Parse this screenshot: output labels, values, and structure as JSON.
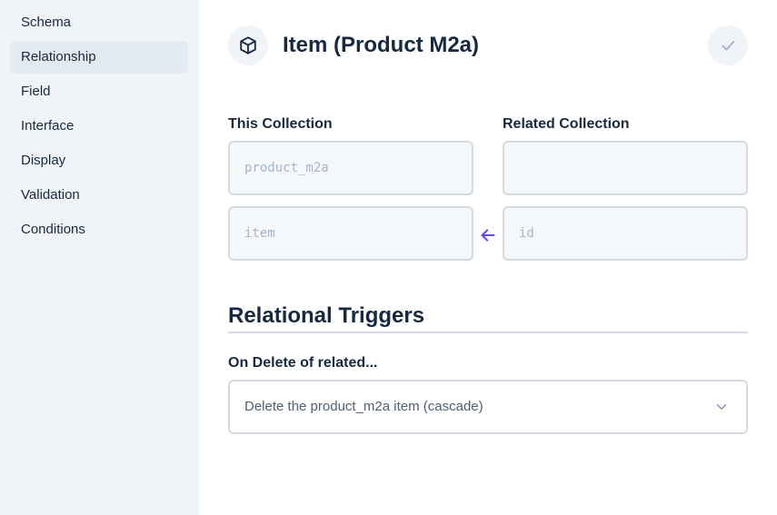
{
  "sidebar": {
    "items": [
      {
        "label": "Schema"
      },
      {
        "label": "Relationship",
        "active": true
      },
      {
        "label": "Field"
      },
      {
        "label": "Interface"
      },
      {
        "label": "Display"
      },
      {
        "label": "Validation"
      },
      {
        "label": "Conditions"
      }
    ]
  },
  "header": {
    "title": "Item (Product M2a)",
    "icon": "box-icon",
    "save_icon": "check-icon"
  },
  "relationship": {
    "this_collection_label": "This Collection",
    "related_collection_label": "Related Collection",
    "this_collection_value": "product_m2a",
    "related_collection_value": "",
    "this_field_value": "item",
    "related_field_value": "id",
    "arrow_icon": "arrow-left-icon"
  },
  "triggers": {
    "title": "Relational Triggers",
    "on_delete_label": "On Delete of related...",
    "on_delete_value": "Delete the product_m2a item (cascade)"
  },
  "colors": {
    "accent": "#6644ff",
    "sidebar_bg": "#f0f4f9",
    "border": "#d3dae4",
    "text": "#172940"
  }
}
